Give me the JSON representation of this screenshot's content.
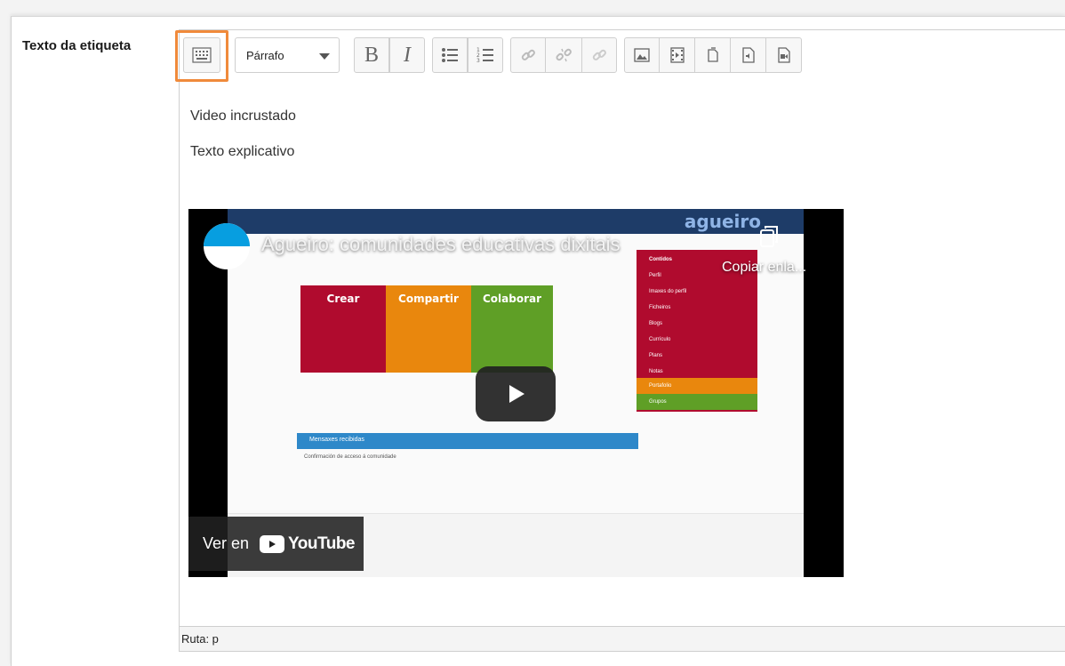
{
  "field": {
    "label": "Texto da etiqueta"
  },
  "toolbar": {
    "format_select": "Párrafo",
    "bold_label": "B",
    "italic_label": "I"
  },
  "content": {
    "line1": "Video incrustado",
    "line2": "Texto explicativo"
  },
  "video": {
    "title": "Agueiro: comunidades educativas dixitais",
    "copy_link": "Copiar enla...",
    "watch_on": "Ver en",
    "youtube_brand": "YouTube",
    "site_brand": "agueiro",
    "puzzle_labels": [
      "Crear",
      "Compartir",
      "Colaborar"
    ],
    "menu_title": "Contidos",
    "menu_items": [
      "Perfil",
      "Imaxes do perfil",
      "Ficheiros",
      "Blogs",
      "Currículo",
      "Plans",
      "Notas"
    ],
    "menu_portfolio": "Portafolio",
    "menu_groups": "Grupos",
    "messages_header": "Mensaxes recibidas",
    "messages_item": "Confirmación de acceso á comunidade",
    "colors": {
      "crear": "#b00b2e",
      "compartir": "#e9870d",
      "colaborar": "#5f9f26",
      "accent": "#f08a3b"
    }
  },
  "status": {
    "path": "Ruta: p"
  }
}
